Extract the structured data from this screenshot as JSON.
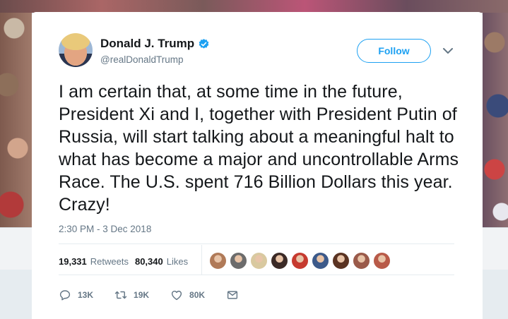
{
  "user": {
    "name": "Donald J. Trump",
    "handle": "@realDonaldTrump",
    "avatar_icon": "profile-photo"
  },
  "follow_button": {
    "label": "Follow"
  },
  "tweet": {
    "text": "I am certain that, at some time in the future, President Xi and I, together with President Putin of Russia, will start talking about a meaningful halt to what has become a major and uncontrollable Arms Race. The U.S. spent 716 Billion Dollars this year. Crazy!",
    "timestamp": "2:30 PM - 3 Dec 2018"
  },
  "stats": {
    "retweets_count": "19,331",
    "retweets_label": "Retweets",
    "likes_count": "80,340",
    "likes_label": "Likes"
  },
  "likers": [
    {
      "color": "#b07a58"
    },
    {
      "color": "#6c6c6c"
    },
    {
      "color": "#d9c9a0"
    },
    {
      "color": "#3b2a26"
    },
    {
      "color": "#c63a2f"
    },
    {
      "color": "#3c5a8a"
    },
    {
      "color": "#5a3322"
    },
    {
      "color": "#9a5a4a"
    },
    {
      "color": "#b85a48"
    }
  ],
  "actions": {
    "reply_count": "13K",
    "retweet_count": "19K",
    "like_count": "80K"
  },
  "colors": {
    "accent": "#1da1f2",
    "text": "#14171a",
    "secondary": "#657786"
  }
}
